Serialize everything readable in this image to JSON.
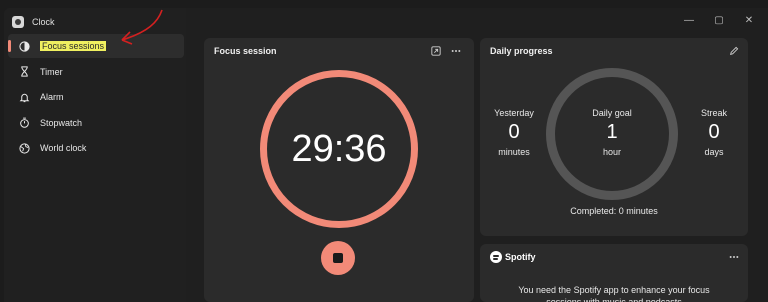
{
  "app": {
    "title": "Clock"
  },
  "sidebar": {
    "items": [
      {
        "label": "Focus sessions",
        "active": true,
        "icon": "focus-icon"
      },
      {
        "label": "Timer",
        "active": false,
        "icon": "hourglass-icon"
      },
      {
        "label": "Alarm",
        "active": false,
        "icon": "bell-icon"
      },
      {
        "label": "Stopwatch",
        "active": false,
        "icon": "stopwatch-icon"
      },
      {
        "label": "World clock",
        "active": false,
        "icon": "globe-icon"
      }
    ]
  },
  "focus": {
    "title": "Focus session",
    "time": "29:36",
    "accent": "#f28a78"
  },
  "daily": {
    "title": "Daily progress",
    "yesterday": {
      "label": "Yesterday",
      "value": "0",
      "unit": "minutes"
    },
    "goal": {
      "label": "Daily goal",
      "value": "1",
      "unit": "hour"
    },
    "streak": {
      "label": "Streak",
      "value": "0",
      "unit": "days"
    },
    "completed": "Completed: 0 minutes"
  },
  "spotify": {
    "brand": "Spotify",
    "message": "You need the Spotify app to enhance your focus sessions with music and podcasts"
  },
  "window_controls": {
    "minimize": "—",
    "maximize": "▢",
    "close": "✕"
  }
}
